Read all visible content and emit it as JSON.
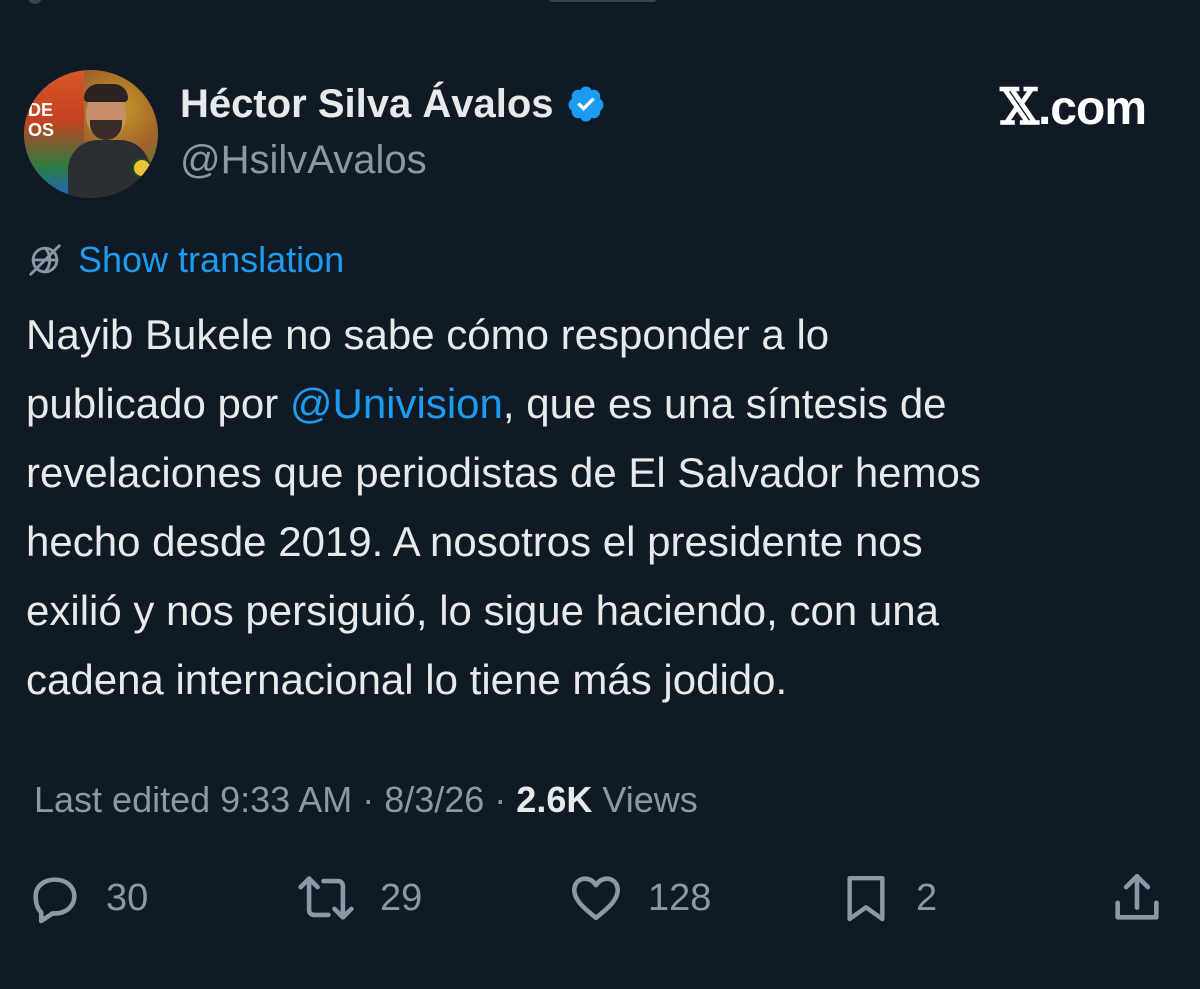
{
  "author": {
    "display_name": "Héctor Silva Ávalos",
    "handle": "@HsilvAvalos",
    "avatar_text": "DE\nOS"
  },
  "brand": {
    "x_mark": "𝕏",
    "domain_suffix": ".com"
  },
  "translation": {
    "label": "Show translation",
    "icon": "globe-slash-icon"
  },
  "tweet": {
    "lines": [
      "Nayib Bukele no sabe cómo responder a lo",
      "publicado por ",
      "@Univision",
      ", que es una síntesis de",
      "revelaciones que periodistas de El Salvador hemos",
      "hecho desde 2019. A nosotros el presidente nos",
      "exilió y nos persiguió, lo sigue haciendo, con una",
      "cadena internacional lo tiene más jodido."
    ]
  },
  "meta": {
    "prefix": "Last edited 9:33 AM · 8/3/26 · ",
    "views_count": "2.6K",
    "views_label": " Views"
  },
  "actions": {
    "replies": "30",
    "reposts": "29",
    "likes": "128",
    "bookmarks": "2"
  },
  "colors": {
    "background": "#101a24",
    "text": "#e7e9ea",
    "muted": "#8b98a5",
    "accent": "#1d9bf0"
  }
}
